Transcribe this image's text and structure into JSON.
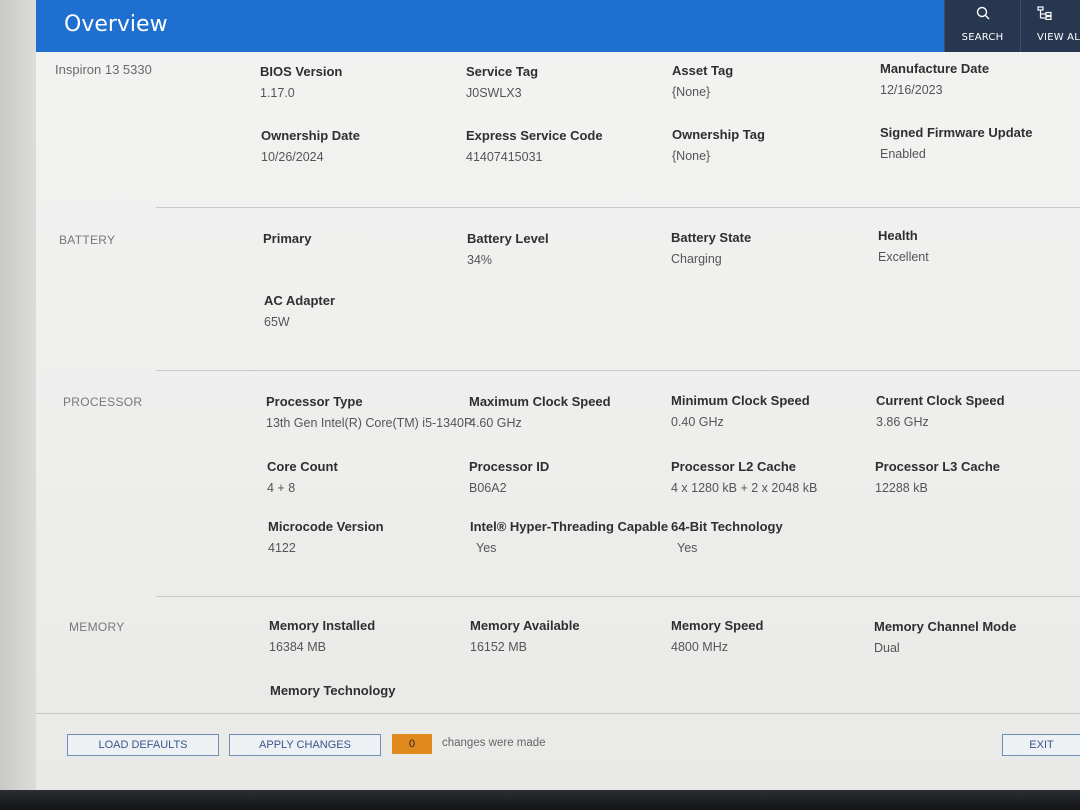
{
  "header": {
    "title": "Overview",
    "search_label": "SEARCH",
    "view_all_label": "VIEW AL",
    "color": "#1f6fd1"
  },
  "system": {
    "model": "Inspiron 13 5330",
    "fields": [
      {
        "label": "BIOS Version",
        "value": "1.17.0"
      },
      {
        "label": "Service Tag",
        "value": "J0SWLX3"
      },
      {
        "label": "Asset Tag",
        "value": "{None}"
      },
      {
        "label": "Manufacture Date",
        "value": "12/16/2023"
      },
      {
        "label": "Ownership Date",
        "value": "10/26/2024"
      },
      {
        "label": "Express Service Code",
        "value": "41407415031"
      },
      {
        "label": "Ownership Tag",
        "value": "{None}"
      },
      {
        "label": "Signed Firmware Update",
        "value": "Enabled"
      }
    ]
  },
  "battery": {
    "section_label": "BATTERY",
    "fields": [
      {
        "label": "Primary",
        "value": ""
      },
      {
        "label": "Battery Level",
        "value": "34%"
      },
      {
        "label": "Battery State",
        "value": "Charging"
      },
      {
        "label": "Health",
        "value": "Excellent"
      },
      {
        "label": "AC Adapter",
        "value": "65W"
      }
    ]
  },
  "processor": {
    "section_label": "PROCESSOR",
    "fields": [
      {
        "label": "Processor Type",
        "value": "13th Gen Intel(R) Core(TM) i5-1340P"
      },
      {
        "label": "Maximum Clock Speed",
        "value": "4.60 GHz"
      },
      {
        "label": "Minimum Clock Speed",
        "value": "0.40 GHz"
      },
      {
        "label": "Current Clock Speed",
        "value": "3.86 GHz"
      },
      {
        "label": "Core Count",
        "value": "4 + 8"
      },
      {
        "label": "Processor ID",
        "value": "B06A2"
      },
      {
        "label": "Processor L2 Cache",
        "value": "4 x 1280  kB + 2 x 2048  kB"
      },
      {
        "label": "Processor L3 Cache",
        "value": "12288 kB"
      },
      {
        "label": "Microcode Version",
        "value": "4122"
      },
      {
        "label": "Intel® Hyper-Threading Capable",
        "value": "Yes"
      },
      {
        "label": "64-Bit Technology",
        "value": "Yes"
      }
    ]
  },
  "memory": {
    "section_label": "MEMORY",
    "fields": [
      {
        "label": "Memory Installed",
        "value": "16384 MB"
      },
      {
        "label": "Memory Available",
        "value": "16152 MB"
      },
      {
        "label": "Memory Speed",
        "value": "4800 MHz"
      },
      {
        "label": "Memory Channel Mode",
        "value": "Dual"
      },
      {
        "label": "Memory Technology",
        "value": ""
      }
    ]
  },
  "footer": {
    "load_defaults_label": "LOAD DEFAULTS",
    "apply_changes_label": "APPLY CHANGES",
    "changes_count": "0",
    "changes_text": "changes were made",
    "exit_label": "EXIT",
    "badge_color": "#e08a1e"
  }
}
